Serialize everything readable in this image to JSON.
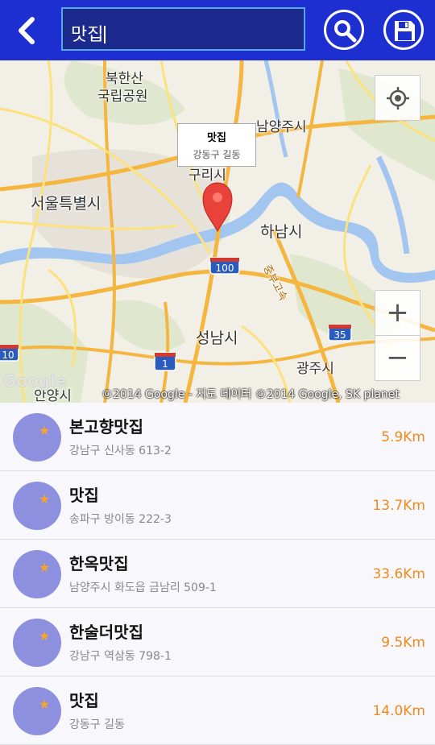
{
  "search": {
    "query": "맛집"
  },
  "map": {
    "callout": {
      "title": "맛집",
      "subtitle": "강동구 길동"
    },
    "labels": {
      "bukhansan": "북한산",
      "national_park": "국립공원",
      "namyangju": "남양주시",
      "seoul": "서울특별시",
      "guri": "구리시",
      "hanam": "하남시",
      "seongnam": "성남시",
      "gwangju": "광주시",
      "anyang": "안양시",
      "expressway": "중부고속"
    },
    "shields": {
      "r100": "100",
      "r35": "35",
      "r1": "1",
      "r10": "10"
    },
    "zoom_in": "+",
    "zoom_out": "−",
    "google": "Google",
    "copyright": "©2014 Google - 지도 데이터 ©2014 Google, SK planet"
  },
  "results": [
    {
      "name": "본고향맛집",
      "address": "강남구 신사동 613-2",
      "distance": "5.9Km"
    },
    {
      "name": "맛집",
      "address": "송파구 방이동 222-3",
      "distance": "13.7Km"
    },
    {
      "name": "한옥맛집",
      "address": "남양주시 화도읍 금남리 509-1",
      "distance": "33.6Km"
    },
    {
      "name": "한술더맛집",
      "address": "강남구 역삼동 798-1",
      "distance": "9.5Km"
    },
    {
      "name": "맛집",
      "address": "강동구 길동",
      "distance": "14.0Km"
    }
  ],
  "colors": {
    "topbar": "#1e2fd1",
    "distance": "#f08a1a",
    "avatar": "#8c90df"
  }
}
